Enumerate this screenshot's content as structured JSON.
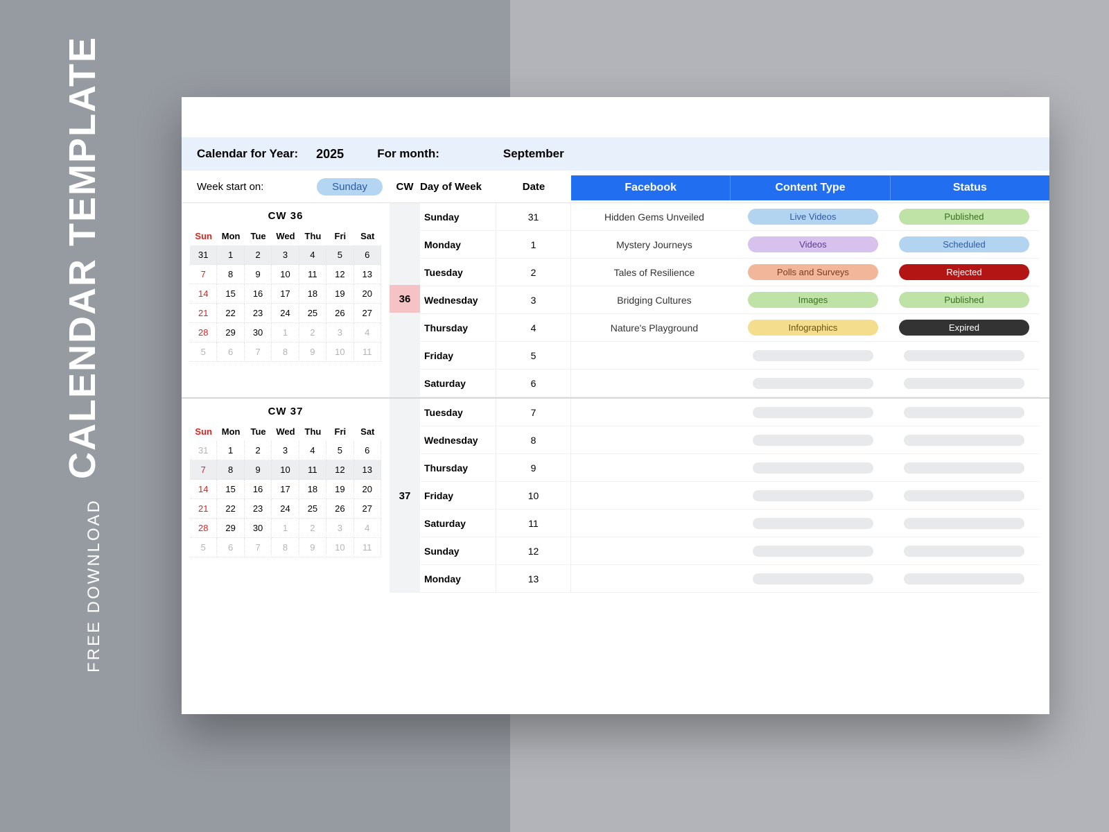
{
  "promo": {
    "small": "FREE DOWNLOAD",
    "big": "CALENDAR TEMPLATE"
  },
  "header": {
    "label": "Calendar for Year:",
    "year": "2025",
    "forMonthLabel": "For month:",
    "month": "September"
  },
  "sub": {
    "weekStartLabel": "Week start on:",
    "weekStartValue": "Sunday",
    "cwLabel": "CW",
    "dowLabel": "Day of Week",
    "dateLabel": "Date",
    "cols": [
      "Facebook",
      "Content Type",
      "Status"
    ]
  },
  "weeks": [
    {
      "cwTitle": "CW 36",
      "cwNumber": "36",
      "cwHighlight": true,
      "minical": {
        "headers": [
          "Sun",
          "Mon",
          "Tue",
          "Wed",
          "Thu",
          "Fri",
          "Sat"
        ],
        "rows": [
          [
            {
              "v": "31",
              "cls": "hl"
            },
            {
              "v": "1",
              "cls": "hl"
            },
            {
              "v": "2",
              "cls": "hl"
            },
            {
              "v": "3",
              "cls": "hl"
            },
            {
              "v": "4",
              "cls": "hl"
            },
            {
              "v": "5",
              "cls": "hl"
            },
            {
              "v": "6",
              "cls": "hl"
            }
          ],
          [
            {
              "v": "7",
              "cls": "sun"
            },
            {
              "v": "8"
            },
            {
              "v": "9"
            },
            {
              "v": "10"
            },
            {
              "v": "11"
            },
            {
              "v": "12"
            },
            {
              "v": "13"
            }
          ],
          [
            {
              "v": "14",
              "cls": "sun"
            },
            {
              "v": "15"
            },
            {
              "v": "16"
            },
            {
              "v": "17"
            },
            {
              "v": "18"
            },
            {
              "v": "19"
            },
            {
              "v": "20"
            }
          ],
          [
            {
              "v": "21",
              "cls": "sun"
            },
            {
              "v": "22"
            },
            {
              "v": "23"
            },
            {
              "v": "24"
            },
            {
              "v": "25"
            },
            {
              "v": "26"
            },
            {
              "v": "27"
            }
          ],
          [
            {
              "v": "28",
              "cls": "sun"
            },
            {
              "v": "29"
            },
            {
              "v": "30"
            },
            {
              "v": "1",
              "cls": "otherm"
            },
            {
              "v": "2",
              "cls": "otherm"
            },
            {
              "v": "3",
              "cls": "otherm"
            },
            {
              "v": "4",
              "cls": "otherm sun"
            }
          ],
          [
            {
              "v": "5",
              "cls": "otherm sun"
            },
            {
              "v": "6",
              "cls": "otherm"
            },
            {
              "v": "7",
              "cls": "otherm"
            },
            {
              "v": "8",
              "cls": "otherm"
            },
            {
              "v": "9",
              "cls": "otherm"
            },
            {
              "v": "10",
              "cls": "otherm"
            },
            {
              "v": "11",
              "cls": "otherm"
            }
          ]
        ]
      },
      "rows": [
        {
          "day": "Sunday",
          "date": "31",
          "fb": "Hidden Gems Unveiled",
          "ct": {
            "t": "Live Videos",
            "c": "c-blue"
          },
          "st": {
            "t": "Published",
            "c": "c-green"
          }
        },
        {
          "day": "Monday",
          "date": "1",
          "fb": "Mystery Journeys",
          "ct": {
            "t": "Videos",
            "c": "c-purple"
          },
          "st": {
            "t": "Scheduled",
            "c": "c-blue"
          }
        },
        {
          "day": "Tuesday",
          "date": "2",
          "fb": "Tales of Resilience",
          "ct": {
            "t": "Polls and Surveys",
            "c": "c-orange"
          },
          "st": {
            "t": "Rejected",
            "c": "c-red"
          }
        },
        {
          "day": "Wednesday",
          "date": "3",
          "fb": "Bridging Cultures",
          "ct": {
            "t": "Images",
            "c": "c-green"
          },
          "st": {
            "t": "Published",
            "c": "c-green"
          }
        },
        {
          "day": "Thursday",
          "date": "4",
          "fb": "Nature's Playground",
          "ct": {
            "t": "Infographics",
            "c": "c-yellow"
          },
          "st": {
            "t": "Expired",
            "c": "c-dark"
          }
        },
        {
          "day": "Friday",
          "date": "5",
          "fb": "",
          "ct": null,
          "st": null
        },
        {
          "day": "Saturday",
          "date": "6",
          "fb": "",
          "ct": null,
          "st": null
        }
      ]
    },
    {
      "cwTitle": "CW 37",
      "cwNumber": "37",
      "cwHighlight": false,
      "minical": {
        "headers": [
          "Sun",
          "Mon",
          "Tue",
          "Wed",
          "Thu",
          "Fri",
          "Sat"
        ],
        "rows": [
          [
            {
              "v": "31",
              "cls": "otherm"
            },
            {
              "v": "1"
            },
            {
              "v": "2"
            },
            {
              "v": "3"
            },
            {
              "v": "4"
            },
            {
              "v": "5"
            },
            {
              "v": "6"
            }
          ],
          [
            {
              "v": "7",
              "cls": "hl sun"
            },
            {
              "v": "8",
              "cls": "hl"
            },
            {
              "v": "9",
              "cls": "hl"
            },
            {
              "v": "10",
              "cls": "hl"
            },
            {
              "v": "11",
              "cls": "hl"
            },
            {
              "v": "12",
              "cls": "hl"
            },
            {
              "v": "13",
              "cls": "hl"
            }
          ],
          [
            {
              "v": "14",
              "cls": "sun"
            },
            {
              "v": "15"
            },
            {
              "v": "16"
            },
            {
              "v": "17"
            },
            {
              "v": "18"
            },
            {
              "v": "19"
            },
            {
              "v": "20"
            }
          ],
          [
            {
              "v": "21",
              "cls": "sun"
            },
            {
              "v": "22"
            },
            {
              "v": "23"
            },
            {
              "v": "24"
            },
            {
              "v": "25"
            },
            {
              "v": "26"
            },
            {
              "v": "27"
            }
          ],
          [
            {
              "v": "28",
              "cls": "sun"
            },
            {
              "v": "29"
            },
            {
              "v": "30"
            },
            {
              "v": "1",
              "cls": "otherm"
            },
            {
              "v": "2",
              "cls": "otherm"
            },
            {
              "v": "3",
              "cls": "otherm"
            },
            {
              "v": "4",
              "cls": "otherm sun"
            }
          ],
          [
            {
              "v": "5",
              "cls": "otherm sun"
            },
            {
              "v": "6",
              "cls": "otherm"
            },
            {
              "v": "7",
              "cls": "otherm"
            },
            {
              "v": "8",
              "cls": "otherm"
            },
            {
              "v": "9",
              "cls": "otherm"
            },
            {
              "v": "10",
              "cls": "otherm"
            },
            {
              "v": "11",
              "cls": "otherm"
            }
          ]
        ]
      },
      "rows": [
        {
          "day": "Tuesday",
          "date": "7",
          "fb": "",
          "ct": null,
          "st": null
        },
        {
          "day": "Wednesday",
          "date": "8",
          "fb": "",
          "ct": null,
          "st": null
        },
        {
          "day": "Thursday",
          "date": "9",
          "fb": "",
          "ct": null,
          "st": null
        },
        {
          "day": "Friday",
          "date": "10",
          "fb": "",
          "ct": null,
          "st": null
        },
        {
          "day": "Saturday",
          "date": "11",
          "fb": "",
          "ct": null,
          "st": null
        },
        {
          "day": "Sunday",
          "date": "12",
          "fb": "",
          "ct": null,
          "st": null
        },
        {
          "day": "Monday",
          "date": "13",
          "fb": "",
          "ct": null,
          "st": null
        }
      ]
    }
  ]
}
